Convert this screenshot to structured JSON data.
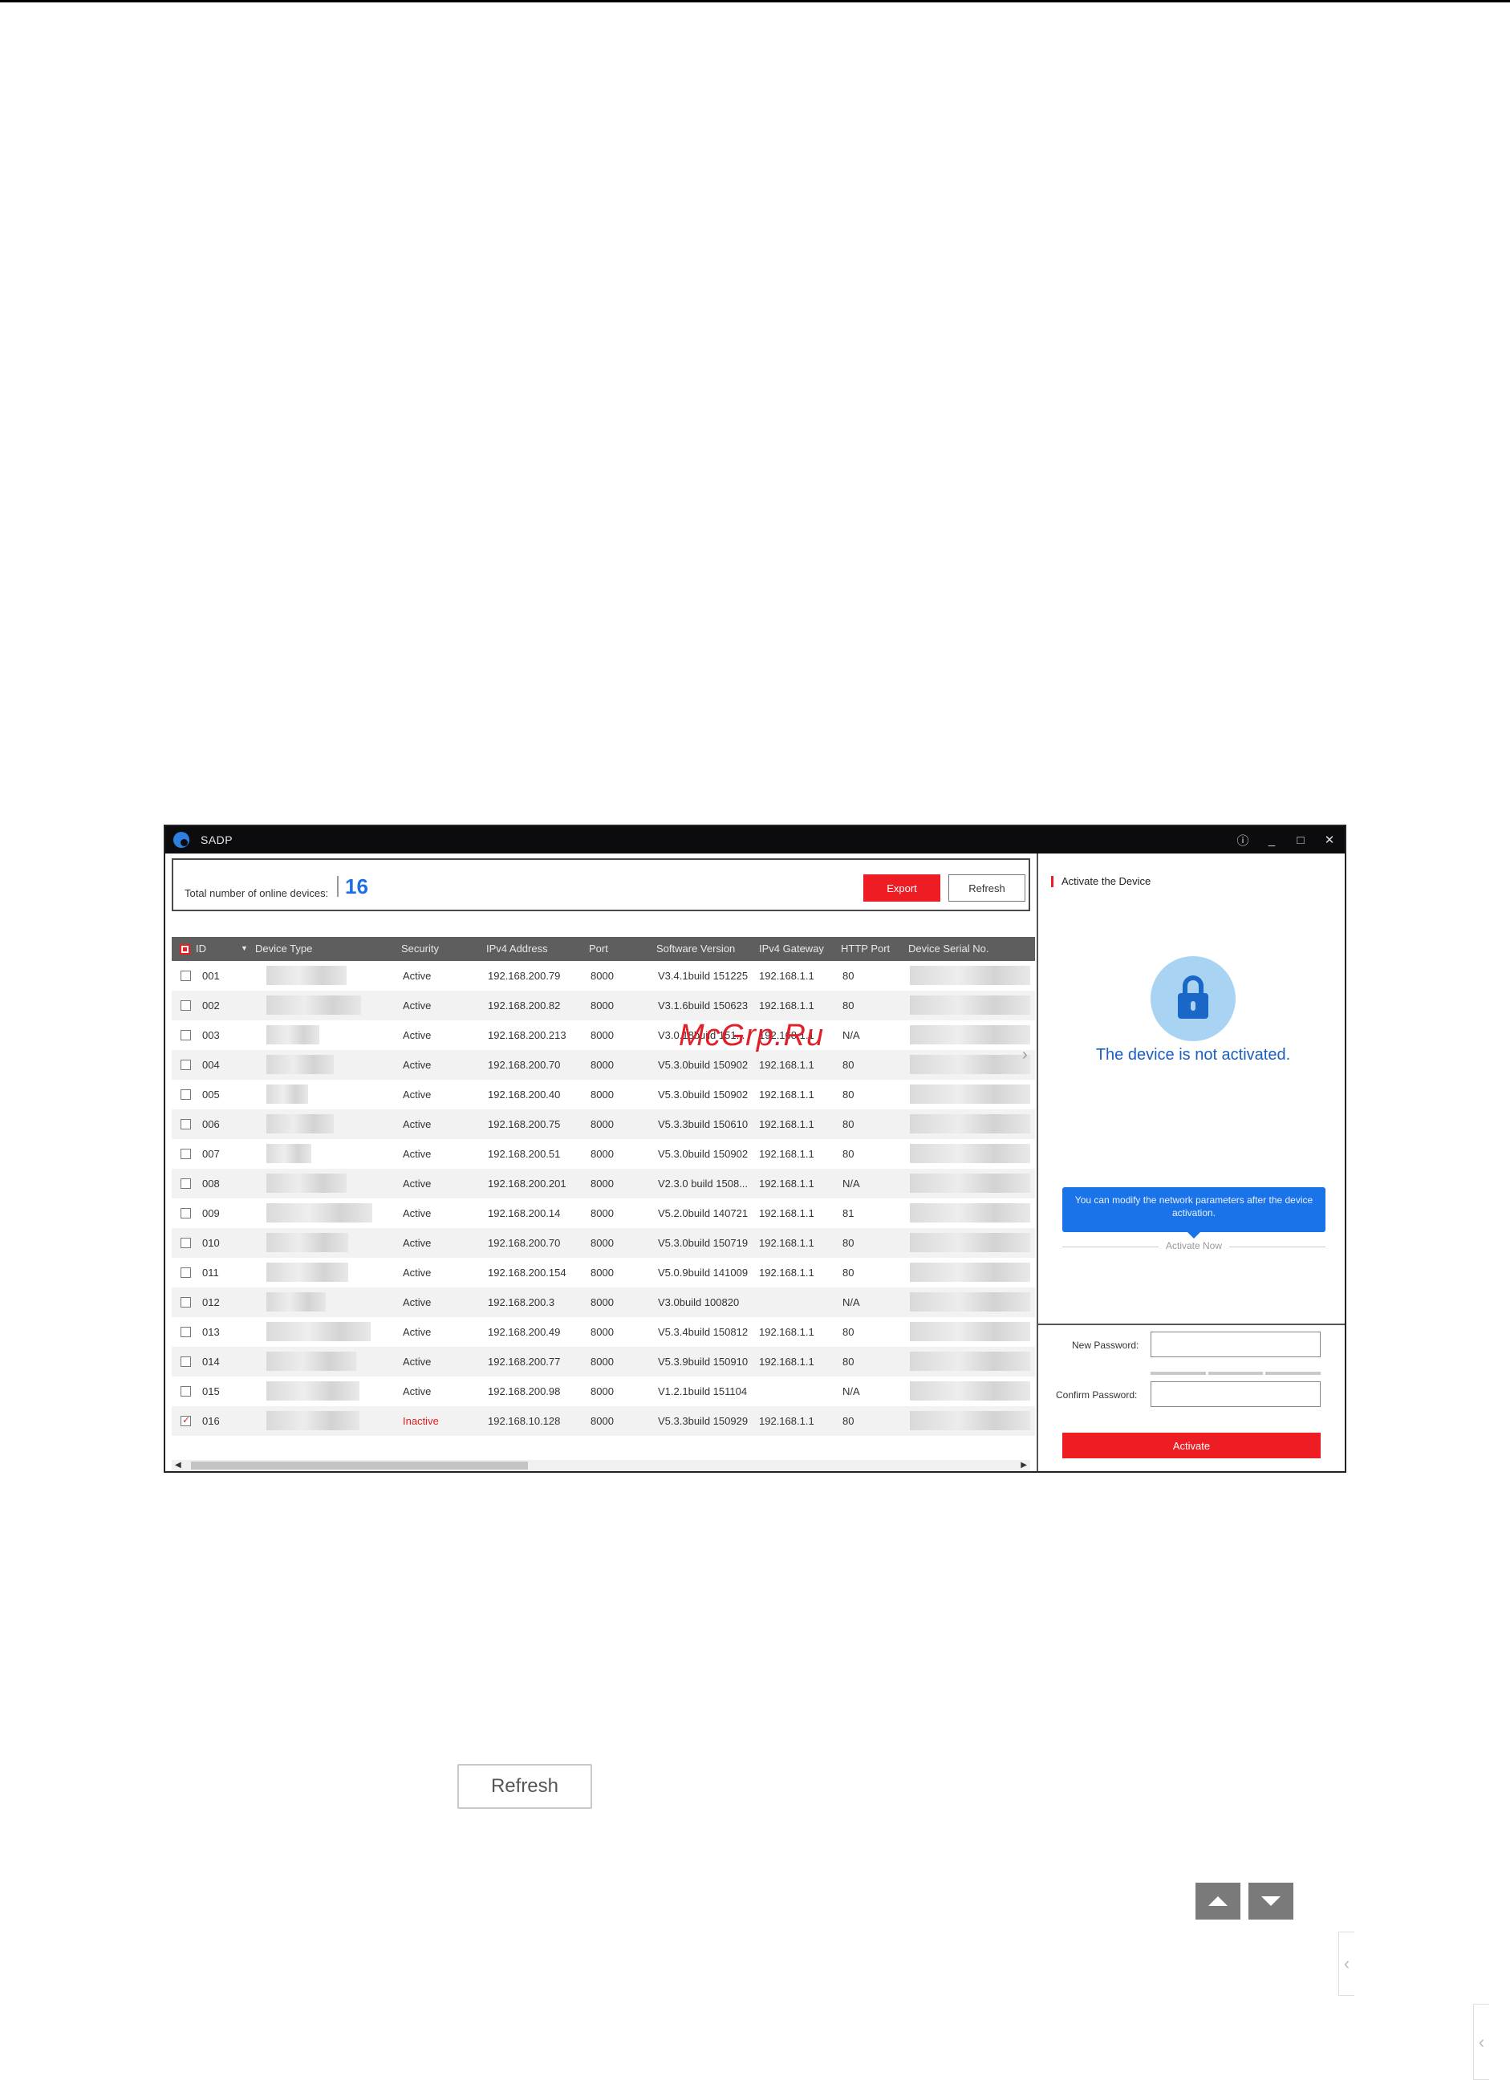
{
  "window": {
    "title": "SADP",
    "controls": {
      "info": "ⓘ",
      "minimize": "_",
      "maximize": "□",
      "close": "✕"
    }
  },
  "summary": {
    "label": "Total number of online devices:",
    "count": "16",
    "export_label": "Export",
    "refresh_label": "Refresh"
  },
  "table": {
    "columns": [
      "ID",
      "Device Type",
      "Security",
      "IPv4 Address",
      "Port",
      "Software Version",
      "IPv4 Gateway",
      "HTTP Port",
      "Device Serial No."
    ],
    "rows": [
      {
        "id": "001",
        "security": "Active",
        "ip": "192.168.200.79",
        "port": "8000",
        "version": "V3.4.1build 151225",
        "gateway": "192.168.1.1",
        "http": "80",
        "checked": false
      },
      {
        "id": "002",
        "security": "Active",
        "ip": "192.168.200.82",
        "port": "8000",
        "version": "V3.1.6build 150623",
        "gateway": "192.168.1.1",
        "http": "80",
        "checked": false
      },
      {
        "id": "003",
        "security": "Active",
        "ip": "192.168.200.213",
        "port": "8000",
        "version": "V3.0.18build 151...",
        "gateway": "192.168.1.1",
        "http": "N/A",
        "checked": false
      },
      {
        "id": "004",
        "security": "Active",
        "ip": "192.168.200.70",
        "port": "8000",
        "version": "V5.3.0build 150902",
        "gateway": "192.168.1.1",
        "http": "80",
        "checked": false
      },
      {
        "id": "005",
        "security": "Active",
        "ip": "192.168.200.40",
        "port": "8000",
        "version": "V5.3.0build 150902",
        "gateway": "192.168.1.1",
        "http": "80",
        "checked": false
      },
      {
        "id": "006",
        "security": "Active",
        "ip": "192.168.200.75",
        "port": "8000",
        "version": "V5.3.3build 150610",
        "gateway": "192.168.1.1",
        "http": "80",
        "checked": false
      },
      {
        "id": "007",
        "security": "Active",
        "ip": "192.168.200.51",
        "port": "8000",
        "version": "V5.3.0build 150902",
        "gateway": "192.168.1.1",
        "http": "80",
        "checked": false
      },
      {
        "id": "008",
        "security": "Active",
        "ip": "192.168.200.201",
        "port": "8000",
        "version": "V2.3.0 build 1508...",
        "gateway": "192.168.1.1",
        "http": "N/A",
        "checked": false
      },
      {
        "id": "009",
        "security": "Active",
        "ip": "192.168.200.14",
        "port": "8000",
        "version": "V5.2.0build 140721",
        "gateway": "192.168.1.1",
        "http": "81",
        "checked": false
      },
      {
        "id": "010",
        "security": "Active",
        "ip": "192.168.200.70",
        "port": "8000",
        "version": "V5.3.0build 150719",
        "gateway": "192.168.1.1",
        "http": "80",
        "checked": false
      },
      {
        "id": "011",
        "security": "Active",
        "ip": "192.168.200.154",
        "port": "8000",
        "version": "V5.0.9build 141009",
        "gateway": "192.168.1.1",
        "http": "80",
        "checked": false
      },
      {
        "id": "012",
        "security": "Active",
        "ip": "192.168.200.3",
        "port": "8000",
        "version": "V3.0build 100820",
        "gateway": "",
        "http": "N/A",
        "checked": false
      },
      {
        "id": "013",
        "security": "Active",
        "ip": "192.168.200.49",
        "port": "8000",
        "version": "V5.3.4build 150812",
        "gateway": "192.168.1.1",
        "http": "80",
        "checked": false
      },
      {
        "id": "014",
        "security": "Active",
        "ip": "192.168.200.77",
        "port": "8000",
        "version": "V5.3.9build 150910",
        "gateway": "192.168.1.1",
        "http": "80",
        "checked": false
      },
      {
        "id": "015",
        "security": "Active",
        "ip": "192.168.200.98",
        "port": "8000",
        "version": "V1.2.1build 151104",
        "gateway": "",
        "http": "N/A",
        "checked": false
      },
      {
        "id": "016",
        "security": "Inactive",
        "ip": "192.168.10.128",
        "port": "8000",
        "version": "V5.3.3build 150929",
        "gateway": "192.168.1.1",
        "http": "80",
        "checked": true
      }
    ]
  },
  "activate_panel": {
    "title": "Activate the Device",
    "status": "The device is not activated.",
    "tip": "You can modify the network parameters after the device activation.",
    "activate_now": "Activate Now",
    "new_password_label": "New Password:",
    "confirm_password_label": "Confirm Password:",
    "activate_label": "Activate"
  },
  "watermark": "McGrp.Ru",
  "refresh_button": "Refresh",
  "colors": {
    "accent_red": "#ee1c23",
    "count_blue": "#1e6fe6",
    "tip_blue": "#1a73e8",
    "titlebar": "#0c0c0f"
  }
}
